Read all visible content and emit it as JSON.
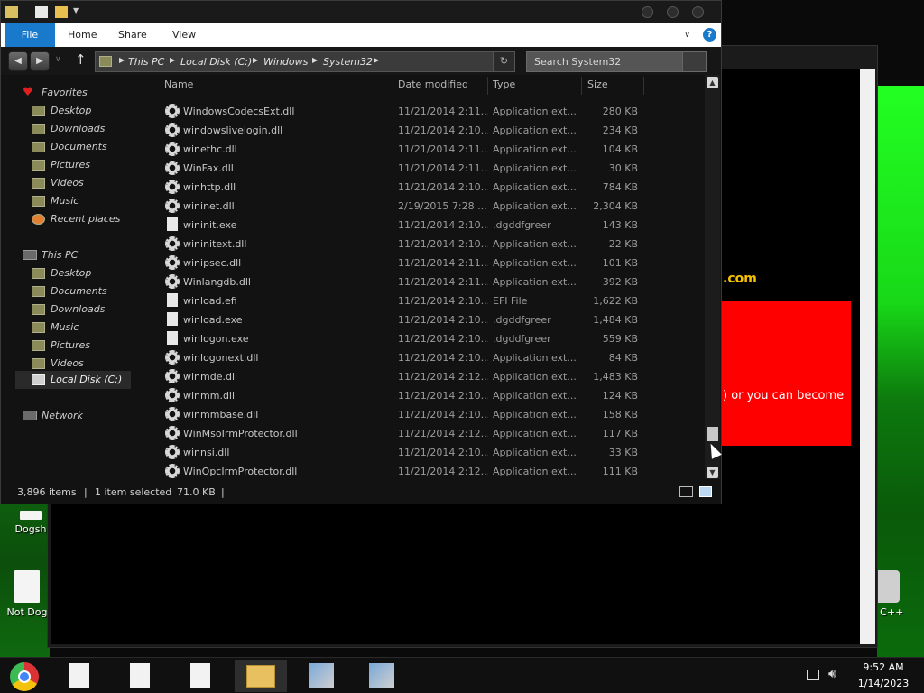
{
  "desktop": {
    "icons": [
      {
        "label": "Dogsh"
      },
      {
        "label": "Not Dog"
      },
      {
        "label": "n C++"
      }
    ]
  },
  "background_window": {
    "dotcom_text": ".com",
    "red_text": ") or you can become"
  },
  "explorer": {
    "ribbon": {
      "file": "File",
      "home": "Home",
      "share": "Share",
      "view": "View"
    },
    "address": {
      "crumbs": [
        "This PC",
        "Local Disk (C:)",
        "Windows",
        "System32"
      ]
    },
    "search": {
      "placeholder": "Search System32"
    },
    "nav": {
      "favorites": "Favorites",
      "favorites_items": [
        "Desktop",
        "Downloads",
        "Documents",
        "Pictures",
        "Videos",
        "Music",
        "Recent places"
      ],
      "this_pc": "This PC",
      "this_pc_items": [
        "Desktop",
        "Documents",
        "Downloads",
        "Music",
        "Pictures",
        "Videos",
        "Local Disk (C:)"
      ],
      "network": "Network"
    },
    "columns": {
      "name": "Name",
      "date": "Date modified",
      "type": "Type",
      "size": "Size"
    },
    "files": [
      {
        "name": "WindowsCodecsExt.dll",
        "date": "11/21/2014 2:11...",
        "type": "Application ext...",
        "size": "280 KB",
        "icon": "gear-icon"
      },
      {
        "name": "windowslivelogin.dll",
        "date": "11/21/2014 2:10...",
        "type": "Application ext...",
        "size": "234 KB",
        "icon": "gear-icon"
      },
      {
        "name": "winethc.dll",
        "date": "11/21/2014 2:11...",
        "type": "Application ext...",
        "size": "104 KB",
        "icon": "gear-icon"
      },
      {
        "name": "WinFax.dll",
        "date": "11/21/2014 2:11...",
        "type": "Application ext...",
        "size": "30 KB",
        "icon": "gear-icon"
      },
      {
        "name": "winhttp.dll",
        "date": "11/21/2014 2:10...",
        "type": "Application ext...",
        "size": "784 KB",
        "icon": "gear-icon"
      },
      {
        "name": "wininet.dll",
        "date": "2/19/2015 7:28 ...",
        "type": "Application ext...",
        "size": "2,304 KB",
        "icon": "gear-icon"
      },
      {
        "name": "wininit.exe",
        "date": "11/21/2014 2:10...",
        "type": ".dgddfgreer",
        "size": "143 KB",
        "icon": "page-icon"
      },
      {
        "name": "wininitext.dll",
        "date": "11/21/2014 2:10...",
        "type": "Application ext...",
        "size": "22 KB",
        "icon": "gear-icon"
      },
      {
        "name": "winipsec.dll",
        "date": "11/21/2014 2:11...",
        "type": "Application ext...",
        "size": "101 KB",
        "icon": "gear-icon"
      },
      {
        "name": "Winlangdb.dll",
        "date": "11/21/2014 2:11...",
        "type": "Application ext...",
        "size": "392 KB",
        "icon": "gear-icon"
      },
      {
        "name": "winload.efi",
        "date": "11/21/2014 2:10...",
        "type": "EFI File",
        "size": "1,622 KB",
        "icon": "page-icon"
      },
      {
        "name": "winload.exe",
        "date": "11/21/2014 2:10...",
        "type": ".dgddfgreer",
        "size": "1,484 KB",
        "icon": "page-icon"
      },
      {
        "name": "winlogon.exe",
        "date": "11/21/2014 2:10...",
        "type": ".dgddfgreer",
        "size": "559 KB",
        "icon": "page-icon"
      },
      {
        "name": "winlogonext.dll",
        "date": "11/21/2014 2:10...",
        "type": "Application ext...",
        "size": "84 KB",
        "icon": "gear-icon"
      },
      {
        "name": "winmde.dll",
        "date": "11/21/2014 2:12...",
        "type": "Application ext...",
        "size": "1,483 KB",
        "icon": "gear-icon"
      },
      {
        "name": "winmm.dll",
        "date": "11/21/2014 2:10...",
        "type": "Application ext...",
        "size": "124 KB",
        "icon": "gear-icon"
      },
      {
        "name": "winmmbase.dll",
        "date": "11/21/2014 2:10...",
        "type": "Application ext...",
        "size": "158 KB",
        "icon": "gear-icon"
      },
      {
        "name": "WinMsoIrmProtector.dll",
        "date": "11/21/2014 2:12...",
        "type": "Application ext...",
        "size": "117 KB",
        "icon": "gear-icon"
      },
      {
        "name": "winnsi.dll",
        "date": "11/21/2014 2:10...",
        "type": "Application ext...",
        "size": "33 KB",
        "icon": "gear-icon"
      },
      {
        "name": "WinOpcIrmProtector.dll",
        "date": "11/21/2014 2:12...",
        "type": "Application ext...",
        "size": "111 KB",
        "icon": "gear-icon"
      }
    ],
    "status": {
      "items": "3,896 items",
      "selected": "1 item selected",
      "size": "71.0 KB"
    }
  },
  "taskbar": {
    "time": "9:52 AM",
    "date": "1/14/2023"
  }
}
